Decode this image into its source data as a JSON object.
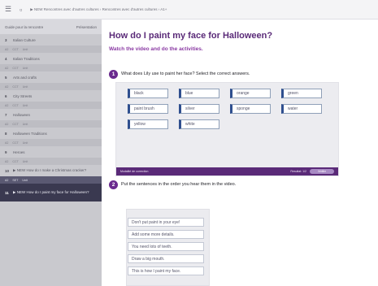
{
  "topbar": {
    "menu_icon": "hamburger-menu-icon",
    "page_icon": "document-icon",
    "breadcrumb": "▶ NEW Rencontres avec d'autres cultures › Rencontres avec d'autres cultures › A1+"
  },
  "sidebar": {
    "header_left": "Guide pour la rencontre",
    "header_right": "Présentation",
    "items": [
      {
        "num": "3",
        "label": "Italian Culture",
        "tags": [
          "A2",
          "CCT",
          "Unit"
        ]
      },
      {
        "num": "4",
        "label": "Italian Traditions",
        "tags": [
          "A2",
          "CCT",
          "Unit"
        ]
      },
      {
        "num": "5",
        "label": "Arts and crafts",
        "tags": [
          "A2",
          "CCT",
          "Unit"
        ]
      },
      {
        "num": "6",
        "label": "City Streets",
        "tags": [
          "A2",
          "CCT",
          "Unit"
        ]
      },
      {
        "num": "7",
        "label": "Halloween",
        "tags": [
          "A2",
          "CCT",
          "Unit"
        ]
      },
      {
        "num": "8",
        "label": "Halloween Traditions",
        "tags": [
          "A2",
          "CCT",
          "Unit"
        ]
      },
      {
        "num": "9",
        "label": "Heroes",
        "tags": [
          "A2",
          "CCT",
          "Unit"
        ]
      },
      {
        "num": "10",
        "label": "▶ NEW How do I make a Christmas cracker?",
        "tags": [
          "A2",
          "SET",
          "Unit"
        ]
      },
      {
        "num": "11",
        "label": "▶ NEW How do I paint my face for Halloween?",
        "tags": []
      }
    ]
  },
  "main": {
    "title": "How do I paint my face for Halloween?",
    "subtitle": "Watch the video and do the activities.",
    "q1": {
      "number": "1",
      "text": "What does Lily use to paint her face? Select the correct answers.",
      "options": [
        "black",
        "blue",
        "orange",
        "green",
        "paint brush",
        "silver",
        "sponge",
        "water",
        "yellow",
        "white"
      ],
      "footer_label": "Modalité de correction",
      "footer_score": "Resultat: 1/2",
      "check_label": "Vérifier"
    },
    "q2": {
      "number": "2",
      "text": "Put the sentences in the order you hear them in the video.",
      "sentences": [
        "Don't put paint in your eye!",
        "Add some more details.",
        "You need lots of teeth.",
        "Draw a big mouth.",
        "This is how I paint my face."
      ]
    }
  },
  "colors": {
    "brand": "#5a2a78",
    "accent": "#8a3aa3",
    "chip_border": "#2f4f8f",
    "sidebar_active": "#3a3950"
  }
}
